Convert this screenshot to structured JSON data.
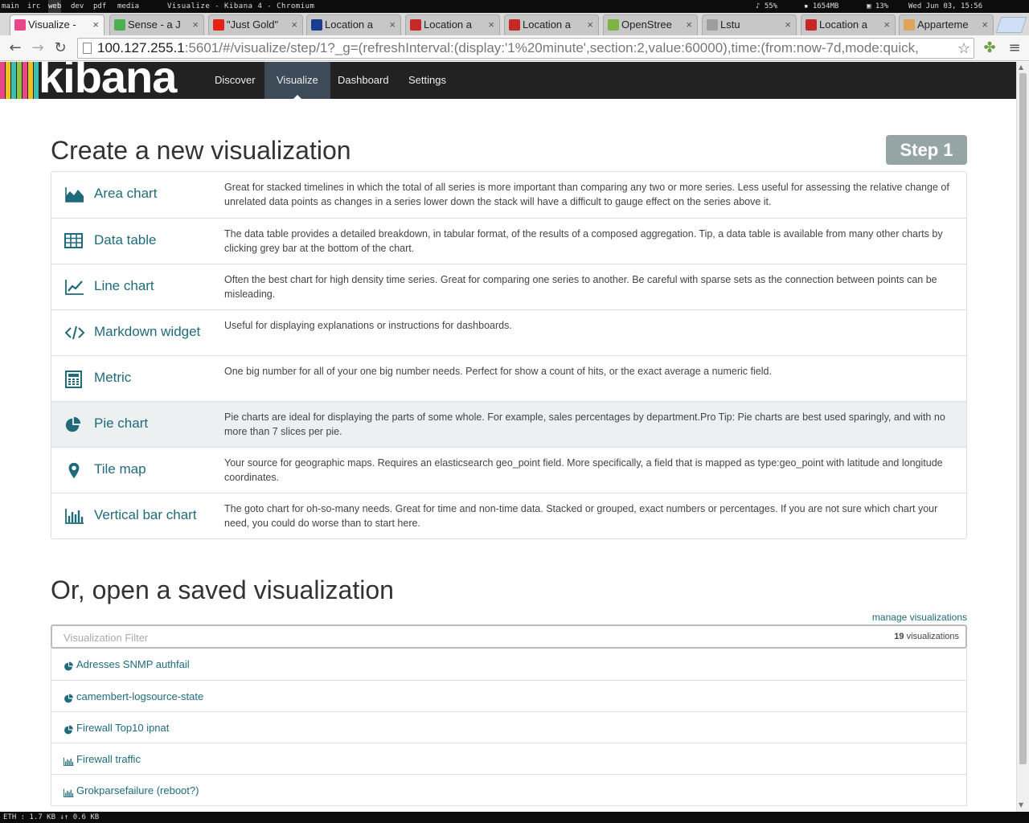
{
  "system_bar": {
    "workspaces": [
      "main",
      "irc",
      "web",
      "dev",
      "pdf",
      "media"
    ],
    "active_workspace": "web",
    "window_title": "Visualize - Kibana 4 - Chromium",
    "volume": "55%",
    "memory": "1654MB",
    "cpu": "13%",
    "clock": "Wed Jun 03, 15:56"
  },
  "tabs": [
    {
      "label": "Visualize -",
      "active": true,
      "color": "#e8478b"
    },
    {
      "label": "Sense - a J",
      "active": false,
      "color": "#4caf50"
    },
    {
      "label": "\"Just Gold\"",
      "active": false,
      "color": "#e62117"
    },
    {
      "label": "Location a",
      "active": false,
      "color": "#1b3e8c"
    },
    {
      "label": "Location a",
      "active": false,
      "color": "#c62828"
    },
    {
      "label": "Location a",
      "active": false,
      "color": "#c62828"
    },
    {
      "label": "OpenStree",
      "active": false,
      "color": "#7cb342"
    },
    {
      "label": "Lstu",
      "active": false,
      "color": "#9e9e9e"
    },
    {
      "label": "Location a",
      "active": false,
      "color": "#c62828"
    },
    {
      "label": "Apparteme",
      "active": false,
      "color": "#e0a35a"
    }
  ],
  "omnibox": {
    "host": "100.127.255.1",
    "rest": ":5601/#/visualize/step/1?_g=(refreshInterval:(display:'1%20minute',section:2,value:60000),time:(from:now-7d,mode:quick,"
  },
  "kibana": {
    "logo_text": "kibana",
    "nav": [
      "Discover",
      "Visualize",
      "Dashboard",
      "Settings"
    ],
    "active_nav": "Visualize"
  },
  "page": {
    "create_title": "Create a new visualization",
    "step_badge": "Step 1",
    "open_title": "Or, open a saved visualization",
    "manage_link": "manage visualizations",
    "filter_placeholder": "Visualization Filter",
    "count_number": "19",
    "count_label": "visualizations"
  },
  "vis_types": [
    {
      "name": "Area chart",
      "icon": "area-chart-icon",
      "desc": "Great for stacked timelines in which the total of all series is more important than comparing any two or more series. Less useful for assessing the relative change of unrelated data points as changes in a series lower down the stack will have a difficult to gauge effect on the series above it."
    },
    {
      "name": "Data table",
      "icon": "table-icon",
      "desc": "The data table provides a detailed breakdown, in tabular format, of the results of a composed aggregation. Tip, a data table is available from many other charts by clicking grey bar at the bottom of the chart."
    },
    {
      "name": "Line chart",
      "icon": "line-chart-icon",
      "desc": "Often the best chart for high density time series. Great for comparing one series to another. Be careful with sparse sets as the connection between points can be misleading."
    },
    {
      "name": "Markdown widget",
      "icon": "code-icon",
      "desc": "Useful for displaying explanations or instructions for dashboards."
    },
    {
      "name": "Metric",
      "icon": "calculator-icon",
      "desc": "One big number for all of your one big number needs. Perfect for show a count of hits, or the exact average a numeric field."
    },
    {
      "name": "Pie chart",
      "icon": "pie-chart-icon",
      "desc": "Pie charts are ideal for displaying the parts of some whole. For example, sales percentages by department.Pro Tip: Pie charts are best used sparingly, and with no more than 7 slices per pie."
    },
    {
      "name": "Tile map",
      "icon": "map-marker-icon",
      "desc": "Your source for geographic maps. Requires an elasticsearch geo_point field. More specifically, a field that is mapped as type:geo_point with latitude and longitude coordinates."
    },
    {
      "name": "Vertical bar chart",
      "icon": "bar-chart-icon",
      "desc": "The goto chart for oh-so-many needs. Great for time and non-time data. Stacked or grouped, exact numbers or percentages. If you are not sure which chart your need, you could do worse than to start here."
    }
  ],
  "saved": [
    {
      "name": "Adresses SNMP authfail",
      "icon": "pie-chart-icon"
    },
    {
      "name": "camembert-logsource-state",
      "icon": "pie-chart-icon"
    },
    {
      "name": "Firewall Top10 ipnat",
      "icon": "pie-chart-icon"
    },
    {
      "name": "Firewall traffic",
      "icon": "bar-chart-icon"
    },
    {
      "name": "Grokparsefailure (reboot?)",
      "icon": "bar-chart-icon"
    }
  ],
  "status_bar": {
    "text": "ETH : 1.7 KB  ↓↑  0.6 KB"
  },
  "colors": {
    "link": "#1f6b7a",
    "nav_bg": "#222222",
    "step_badge": "#95a5a6",
    "logo_stripes": [
      "#e8478b",
      "#f2c01c",
      "#3ebeb0",
      "#8cc63f",
      "#e8478b",
      "#f2c01c",
      "#3ebeb0"
    ]
  }
}
